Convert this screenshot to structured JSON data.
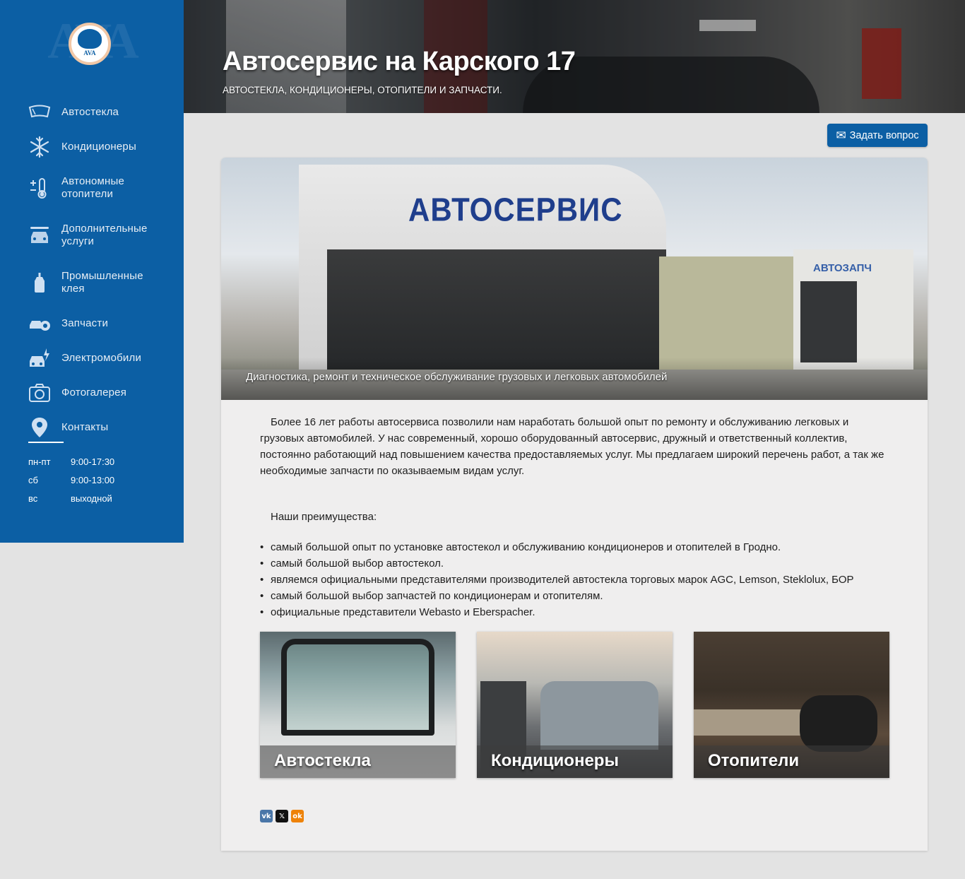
{
  "header": {
    "title": "Автосервис на Карского 17",
    "subtitle": "АВТОСТЕКЛА, КОНДИЦИОНЕРЫ, ОТОПИТЕЛИ И ЗАПЧАСТИ."
  },
  "logo": {
    "text": "AVA"
  },
  "sidebar": {
    "items": [
      {
        "label": "Автостекла",
        "icon": "windshield-icon"
      },
      {
        "label": "Кондиционеры",
        "icon": "snowflake-icon"
      },
      {
        "label": "Автономные\nотопители",
        "icon": "thermometer-icon"
      },
      {
        "label": "Дополнительные\nуслуги",
        "icon": "car-wrench-icon"
      },
      {
        "label": "Промышленные\nклея",
        "icon": "glue-bottle-icon"
      },
      {
        "label": "Запчасти",
        "icon": "car-parts-icon"
      },
      {
        "label": "Электромобили",
        "icon": "electric-car-icon"
      },
      {
        "label": "Фотогалерея",
        "icon": "camera-icon"
      },
      {
        "label": "Контакты",
        "icon": "map-pin-icon"
      }
    ],
    "hours": [
      {
        "day": "пн-пт",
        "time": "9:00-17:30"
      },
      {
        "day": "сб",
        "time": "9:00-13:00"
      },
      {
        "day": "вс",
        "time": "выходной"
      }
    ]
  },
  "ask_button": {
    "label": "Задать вопрос",
    "icon": "envelope-icon"
  },
  "hero": {
    "sign": "АВТОСЕРВИС",
    "sign2": "АВТОЗАПЧ",
    "caption": "Диагностика, ремонт и техническое обслуживание грузовых и легковых автомобилей"
  },
  "content": {
    "intro": "Более 16 лет работы автосервиса позволили нам наработать большой опыт по ремонту и обслуживанию легковых и грузовых автомобилей. У нас современный, хорошо оборудованный автосервис, дружный и ответственный коллектив, постоянно работающий над повышением качества предоставляемых услуг. Мы предлагаем широкий перечень работ, а так же необходимые запчасти по оказываемым видам услуг.",
    "advantages_title": "Наши преимущества:",
    "advantages": [
      "самый большой опыт по установке автостекол и обслуживанию кондиционеров и отопителей в Гродно.",
      "самый большой выбор автостекол.",
      "являемся официальными представителями производителей автостекла торговых марок AGC, Lemson, Steklolux, БОР",
      "самый большой выбор запчастей по кондиционерам и отопителям.",
      "официальные представители Webasto и Eberspacher."
    ]
  },
  "tiles": [
    {
      "label": "Автостекла"
    },
    {
      "label": "Кондиционеры"
    },
    {
      "label": "Отопители"
    }
  ],
  "social": [
    {
      "label": "vk",
      "color": "#4a76a8"
    },
    {
      "label": "𝕏",
      "color": "#111111"
    },
    {
      "label": "ok",
      "color": "#ee8208"
    }
  ],
  "colors": {
    "brand": "#0c5fa4",
    "background": "#e3e3e3",
    "card": "#efeeee"
  }
}
